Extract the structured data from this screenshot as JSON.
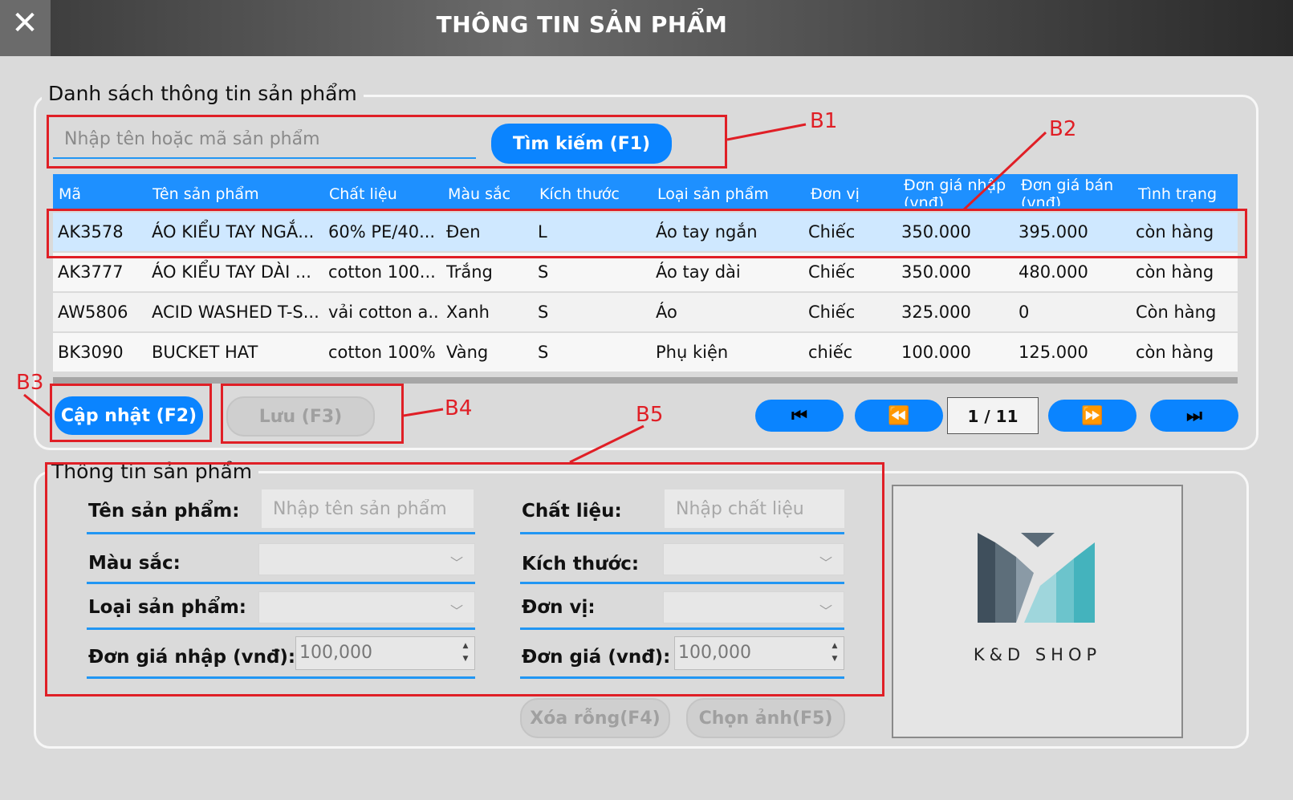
{
  "window": {
    "title": "THÔNG TIN SẢN PHẨM",
    "close_icon": "close-icon"
  },
  "list_group": {
    "title": "Danh sách thông tin sản phẩm"
  },
  "search": {
    "placeholder": "Nhập tên hoặc mã sản phẩm",
    "button_label": "Tìm kiếm (F1)"
  },
  "table": {
    "columns": [
      "Mã",
      "Tên sản phẩm",
      "Chất liệu",
      "Màu sắc",
      "Kích thước",
      "Loại sản phẩm",
      "Đơn vị",
      "Đơn giá nhập (vnđ)",
      "Đơn giá bán (vnđ)",
      "Tình trạng"
    ],
    "rows": [
      [
        "AK3578",
        "ÁO KIỂU TAY NGẮ...",
        "60% PE/40...",
        "Đen",
        "L",
        "Áo tay ngắn",
        "Chiếc",
        "350.000",
        "395.000",
        "còn hàng"
      ],
      [
        "AK3777",
        "ÁO KIỂU TAY DÀI ...",
        "cotton 100...",
        "Trắng",
        "S",
        "Áo tay dài",
        "Chiếc",
        "350.000",
        "480.000",
        "còn hàng"
      ],
      [
        "AW5806",
        "ACID WASHED T-S...",
        "vải cotton a...",
        "Xanh",
        "S",
        "Áo",
        "Chiếc",
        "325.000",
        "0",
        "Còn hàng"
      ],
      [
        "BK3090",
        "BUCKET HAT",
        "cotton 100%",
        "Vàng",
        "S",
        "Phụ kiện",
        "chiếc",
        "100.000",
        "125.000",
        "còn hàng"
      ]
    ],
    "selected_row": 0
  },
  "actions": {
    "update_label": "Cập nhật (F2)",
    "save_label": "Lưu (F3)"
  },
  "pagination": {
    "indicator": "1 / 11",
    "first_icon": "first-page-icon",
    "prev_icon": "prev-page-icon",
    "next_icon": "next-page-icon",
    "last_icon": "last-page-icon"
  },
  "form": {
    "title": "Thông tin sản phẩm",
    "name_label": "Tên sản phẩm:",
    "name_placeholder": "Nhập tên sản phẩm",
    "material_label": "Chất liệu:",
    "material_placeholder": "Nhập chất liệu",
    "color_label": "Màu sắc:",
    "size_label": "Kích thước:",
    "type_label": "Loại sản phẩm:",
    "unit_label": "Đơn vị:",
    "import_price_label": "Đơn giá nhập (vnđ):",
    "import_price_value": "100,000",
    "price_label": "Đơn giá (vnđ):",
    "price_value": "100,000",
    "clear_label": "Xóa rỗng(F4)",
    "choose_image_label": "Chọn ảnh(F5)"
  },
  "logo": {
    "text": "K&D SHOP"
  },
  "annotations": [
    "B1",
    "B2",
    "B3",
    "B4",
    "B5"
  ],
  "colors": {
    "accent": "#0a84ff",
    "header": "#1e90ff",
    "annotation": "#e01f26",
    "selected_row": "#cfe8ff"
  }
}
